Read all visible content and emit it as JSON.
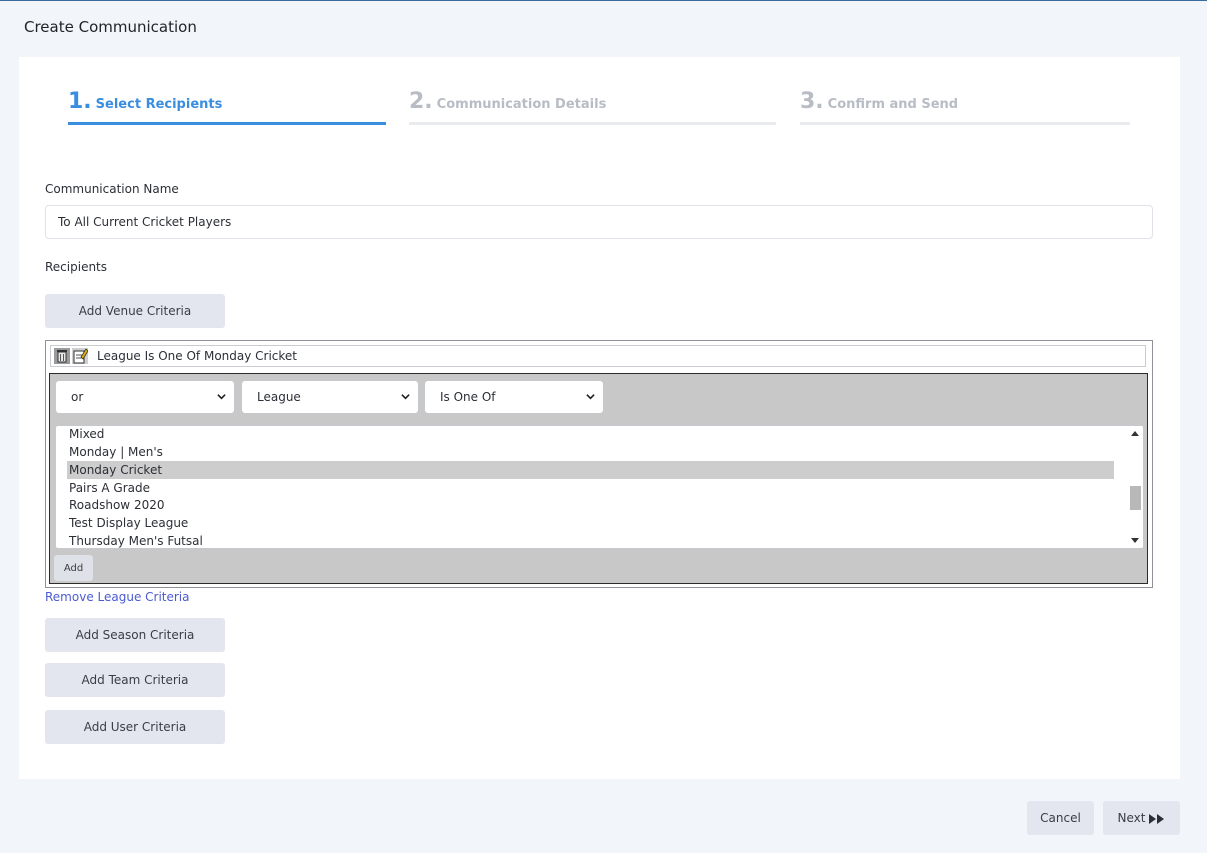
{
  "page": {
    "title": "Create Communication"
  },
  "steps": [
    {
      "num": "1.",
      "label": "Select Recipients",
      "state": "active"
    },
    {
      "num": "2.",
      "label": "Communication Details",
      "state": "inactive"
    },
    {
      "num": "3.",
      "label": "Confirm and Send",
      "state": "inactive"
    }
  ],
  "form": {
    "name_label": "Communication Name",
    "name_value": "To All Current Cricket Players",
    "recipients_label": "Recipients",
    "add_venue_label": "Add Venue Criteria",
    "add_season_label": "Add Season Criteria",
    "add_team_label": "Add Team Criteria",
    "add_user_label": "Add User Criteria",
    "remove_league_label": "Remove League Criteria"
  },
  "criteria": {
    "summary": "League Is One Of Monday Cricket",
    "icons": [
      "trash-icon",
      "edit-icon"
    ],
    "logic_select": "or",
    "field_select": "League",
    "operator_select": "Is One Of",
    "add_label": "Add",
    "options": [
      {
        "label": "Mixed",
        "selected": false
      },
      {
        "label": "Monday | Men's",
        "selected": false
      },
      {
        "label": "Monday Cricket",
        "selected": true
      },
      {
        "label": "Pairs A Grade",
        "selected": false
      },
      {
        "label": "Roadshow 2020",
        "selected": false
      },
      {
        "label": "Test Display League",
        "selected": false
      },
      {
        "label": "Thursday Men's Futsal",
        "selected": false
      }
    ]
  },
  "footer": {
    "cancel_label": "Cancel",
    "next_label": "Next",
    "next_icon": "fast-forward-icon"
  },
  "colors": {
    "accent": "#3a8ee0",
    "link": "#4a5bd1",
    "button_bg": "#e4e6ef",
    "page_bg": "#f2f5f9"
  }
}
